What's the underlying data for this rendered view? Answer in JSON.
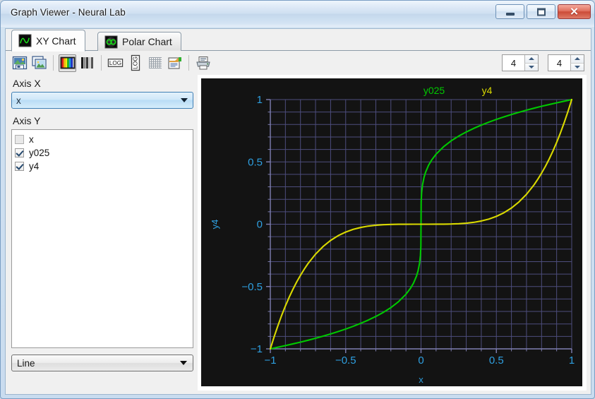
{
  "window": {
    "title": "Graph Viewer - Neural Lab",
    "buttons": {
      "minimize": "minimize",
      "maximize": "restore",
      "close": "✕"
    }
  },
  "tabs": [
    {
      "label": "XY Chart",
      "icon": "xy-chart-icon",
      "active": true
    },
    {
      "label": "Polar Chart",
      "icon": "polar-chart-icon",
      "active": false
    }
  ],
  "toolbar": {
    "buttons": [
      {
        "name": "save-image-button",
        "icon": "save-image-icon",
        "pressed": false
      },
      {
        "name": "copy-image-button",
        "icon": "copy-image-icon",
        "pressed": false
      },
      {
        "name": "color-palette-button",
        "icon": "color-bars-icon",
        "pressed": true
      },
      {
        "name": "grayscale-palette-button",
        "icon": "gray-bars-icon",
        "pressed": false
      },
      {
        "name": "log-x-button",
        "icon": "log-horizontal-icon",
        "pressed": false
      },
      {
        "name": "log-y-button",
        "icon": "log-vertical-icon",
        "pressed": false
      },
      {
        "name": "grid-toggle-button",
        "icon": "grid-icon",
        "pressed": false
      },
      {
        "name": "legend-button",
        "icon": "legend-icon",
        "pressed": false
      },
      {
        "name": "print-button",
        "icon": "printer-icon",
        "pressed": false
      }
    ],
    "spinner_left": {
      "value": "4",
      "name": "columns-spinner"
    },
    "spinner_right": {
      "value": "4",
      "name": "rows-spinner"
    }
  },
  "left_panel": {
    "axis_x_label": "Axis X",
    "axis_x_value": "x",
    "axis_y_label": "Axis Y",
    "series_list": [
      {
        "label": "x",
        "checked": false
      },
      {
        "label": "y025",
        "checked": true
      },
      {
        "label": "y4",
        "checked": true
      }
    ],
    "plot_type_value": "Line"
  },
  "chart_data": {
    "type": "line",
    "title": "",
    "xlabel": "x",
    "ylabel": "y4",
    "xlim": [
      -1,
      1
    ],
    "ylim": [
      -1,
      1
    ],
    "xticks": [
      -1,
      -0.5,
      0,
      0.5,
      1
    ],
    "xticklabels": [
      "-1",
      "-0.5",
      "0",
      "0.5",
      "1"
    ],
    "yticks": [
      -1,
      -0.5,
      0,
      0.5,
      1
    ],
    "yticklabels": [
      "-1",
      "-0.5",
      "0",
      "0.5",
      "1"
    ],
    "minor_ticks_per_major": 5,
    "grid": true,
    "legend_position": "top-center",
    "background": "#131313",
    "grid_color": "#4d4d7d",
    "axis_color": "#7f7fb2",
    "tick_label_color": "#2e9fe0",
    "axis_label_color": "#2e9fe0",
    "series": [
      {
        "name": "y025",
        "color": "#00c800",
        "expression": "sign(x)*abs(x)^0.25",
        "x": [
          -1,
          -0.95,
          -0.9,
          -0.85,
          -0.8,
          -0.75,
          -0.7,
          -0.65,
          -0.6,
          -0.55,
          -0.5,
          -0.45,
          -0.4,
          -0.35,
          -0.3,
          -0.25,
          -0.2,
          -0.15,
          -0.1,
          -0.07,
          -0.05,
          -0.03,
          -0.02,
          -0.01,
          -0.004,
          -0.001,
          0,
          0.001,
          0.004,
          0.01,
          0.02,
          0.03,
          0.05,
          0.07,
          0.1,
          0.15,
          0.2,
          0.25,
          0.3,
          0.35,
          0.4,
          0.45,
          0.5,
          0.55,
          0.6,
          0.65,
          0.7,
          0.75,
          0.8,
          0.85,
          0.9,
          0.95,
          1
        ],
        "y": [
          -1,
          -0.987,
          -0.974,
          -0.96,
          -0.946,
          -0.931,
          -0.915,
          -0.898,
          -0.88,
          -0.861,
          -0.841,
          -0.819,
          -0.795,
          -0.769,
          -0.74,
          -0.707,
          -0.669,
          -0.622,
          -0.562,
          -0.514,
          -0.473,
          -0.416,
          -0.376,
          -0.316,
          -0.252,
          -0.178,
          0,
          0.178,
          0.252,
          0.316,
          0.376,
          0.416,
          0.473,
          0.514,
          0.562,
          0.622,
          0.669,
          0.707,
          0.74,
          0.769,
          0.795,
          0.819,
          0.841,
          0.861,
          0.88,
          0.898,
          0.915,
          0.931,
          0.946,
          0.96,
          0.974,
          0.987,
          1
        ]
      },
      {
        "name": "y4",
        "color": "#d9d900",
        "expression": "sign(x)*abs(x)^4",
        "x": [
          -1,
          -0.975,
          -0.95,
          -0.925,
          -0.9,
          -0.875,
          -0.85,
          -0.825,
          -0.8,
          -0.775,
          -0.75,
          -0.7,
          -0.65,
          -0.6,
          -0.55,
          -0.5,
          -0.45,
          -0.4,
          -0.35,
          -0.3,
          -0.25,
          -0.2,
          -0.15,
          -0.1,
          -0.05,
          0,
          0.05,
          0.1,
          0.15,
          0.2,
          0.25,
          0.3,
          0.35,
          0.4,
          0.45,
          0.5,
          0.55,
          0.6,
          0.65,
          0.7,
          0.75,
          0.775,
          0.8,
          0.825,
          0.85,
          0.875,
          0.9,
          0.925,
          0.95,
          0.975,
          1
        ],
        "y": [
          -1,
          -0.904,
          -0.815,
          -0.732,
          -0.656,
          -0.586,
          -0.522,
          -0.463,
          -0.41,
          -0.361,
          -0.316,
          -0.24,
          -0.179,
          -0.13,
          -0.092,
          -0.063,
          -0.041,
          -0.026,
          -0.015,
          -0.008,
          -0.004,
          -0.0016,
          -0.0005,
          -0.0001,
          0,
          0,
          0,
          0.0001,
          0.0005,
          0.0016,
          0.004,
          0.008,
          0.015,
          0.026,
          0.041,
          0.063,
          0.092,
          0.13,
          0.179,
          0.24,
          0.316,
          0.361,
          0.41,
          0.463,
          0.522,
          0.586,
          0.656,
          0.732,
          0.815,
          0.904,
          1
        ]
      }
    ],
    "legend": [
      {
        "label": "y025",
        "color": "#00c800"
      },
      {
        "label": "y4",
        "color": "#d9d900"
      }
    ]
  }
}
